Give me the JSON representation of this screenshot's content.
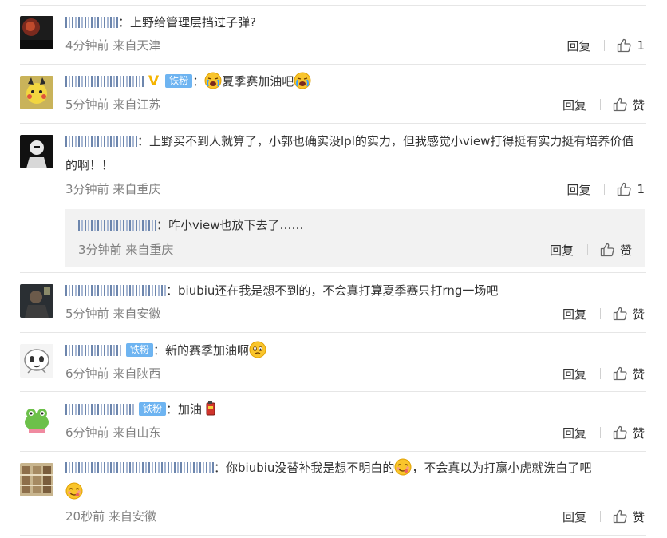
{
  "actions": {
    "reply_label": "回复",
    "like_label": "赞"
  },
  "icons": {
    "like": "thumbs-up-icon",
    "verified": "verified-v-badge"
  },
  "colors": {
    "text": "#333333",
    "meta": "#808080",
    "fan_badge": "#6eb4f1",
    "username_blur": "#6d86ad",
    "verified": "#f5b400"
  },
  "comments": [
    {
      "text": "上野给管理层挡过子弹?",
      "time": "4分钟前",
      "source": "来自天津",
      "likes": "1"
    },
    {
      "fan_badge": "铁粉",
      "text": "夏季赛加油吧",
      "time": "5分钟前",
      "source": "来自江苏",
      "likes": "赞"
    },
    {
      "text": "上野买不到人就算了，小郭也确实没lpl的实力，但我感觉小view打得挺有实力挺有培养价值的啊！！",
      "time": "3分钟前",
      "source": "来自重庆",
      "likes": "1",
      "sub_reply": {
        "text": "咋小view也放下去了……",
        "time": "3分钟前",
        "source": "来自重庆",
        "likes": "赞"
      }
    },
    {
      "text": "biubiu还在我是想不到的，不会真打算夏季赛只打rng一场吧",
      "time": "5分钟前",
      "source": "来自安徽",
      "likes": "赞"
    },
    {
      "fan_badge": "铁粉",
      "text": "新的赛季加油啊",
      "time": "6分钟前",
      "source": "来自陕西",
      "likes": "赞"
    },
    {
      "fan_badge": "铁粉",
      "text": "加油",
      "time": "6分钟前",
      "source": "来自山东",
      "likes": "赞"
    },
    {
      "text_a": "你biubiu没替补我是想不明白的",
      "text_b": "，不会真以为打赢小虎就洗白了吧",
      "time": "20秒前",
      "source": "来自安徽",
      "likes": "赞"
    }
  ]
}
